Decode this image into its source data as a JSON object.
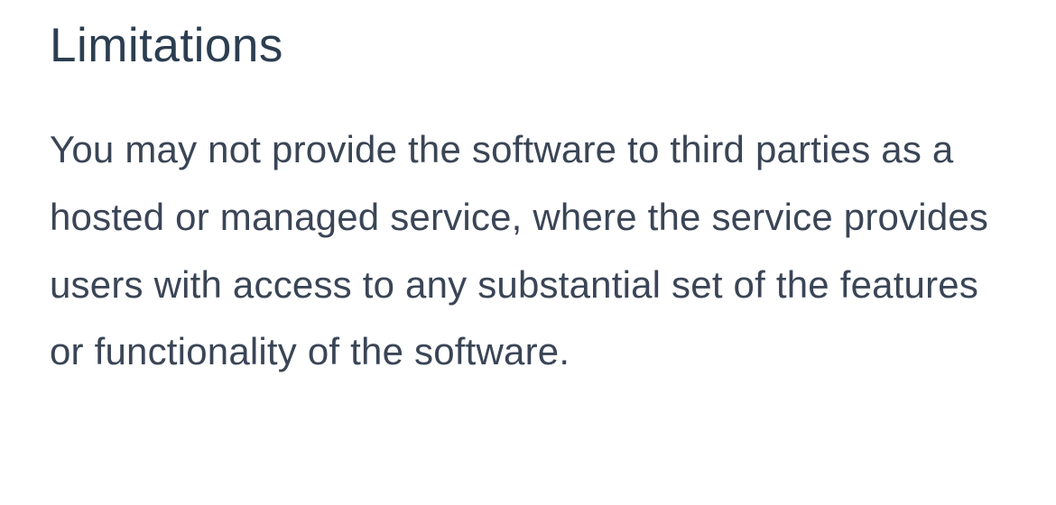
{
  "heading": "Limitations",
  "body": "You may not provide the software to third parties as a hosted or managed service, where the service provides users with access to any substantial set of the features or functionality of the software."
}
